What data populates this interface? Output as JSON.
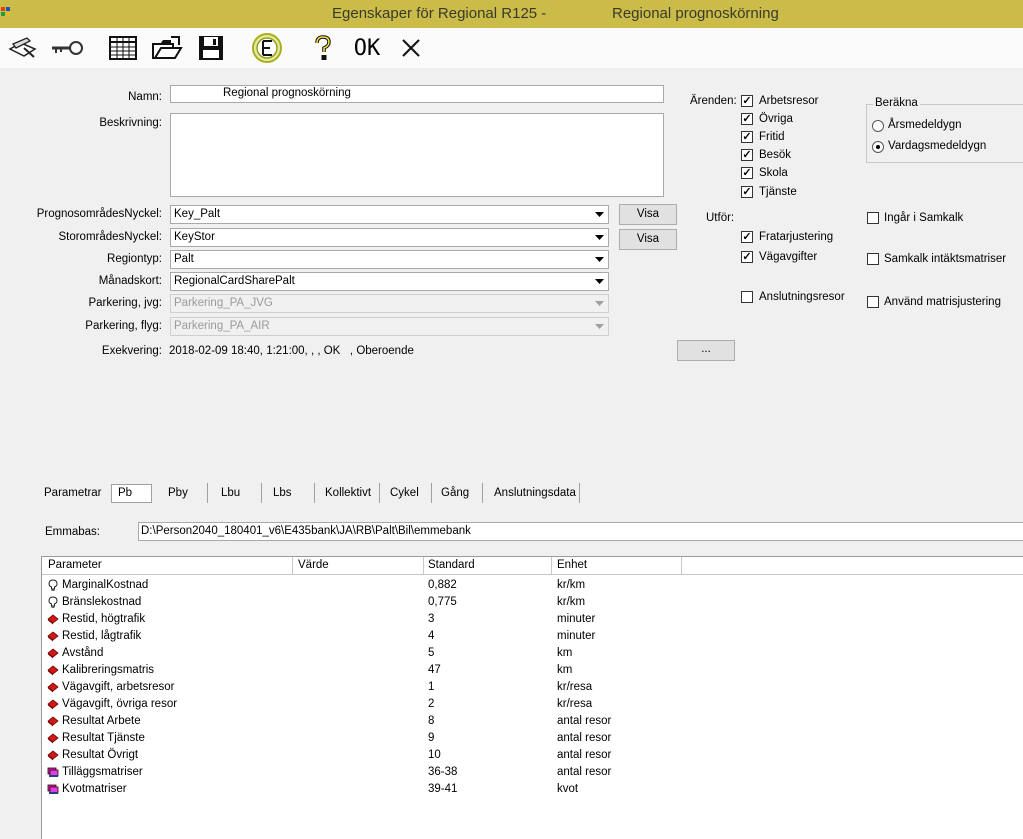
{
  "window": {
    "title_left": "Egenskaper för Regional R125 -",
    "title_right": "Regional prognoskörning"
  },
  "toolbar": {
    "ok_label": "OK",
    "icons": [
      "edit-icon",
      "key-icon",
      "grid-icon",
      "open-folder-icon",
      "save-icon",
      "emme-icon",
      "help-icon",
      "ok-icon",
      "close-icon"
    ]
  },
  "form": {
    "namn_label": "Namn:",
    "namn_value": "Regional prognoskörning",
    "beskrivning_label": "Beskrivning:",
    "beskrivning_value": "",
    "fields": [
      {
        "label": "PrognosområdesNyckel:",
        "value": "Key_Palt",
        "enabled": true
      },
      {
        "label": "StorområdesNyckel:",
        "value": "KeyStor",
        "enabled": true
      },
      {
        "label": "Regiontyp:",
        "value": "Palt",
        "enabled": true
      },
      {
        "label": "Månadskort:",
        "value": "RegionalCardSharePalt",
        "enabled": true
      },
      {
        "label": "Parkering, jvg:",
        "value": "Parkering_PA_JVG",
        "enabled": false
      },
      {
        "label": "Parkering, flyg:",
        "value": "Parkering_PA_AIR",
        "enabled": false
      }
    ],
    "visa_label": "Visa",
    "exekvering_label": "Exekvering:",
    "exekvering_value": "2018-02-09 18:40, 1:21:00, , , OK   , Oberoende",
    "ellipsis_label": "..."
  },
  "arenden": {
    "label": "Ärenden:",
    "items": [
      {
        "label": "Arbetsresor",
        "checked": true
      },
      {
        "label": "Övriga",
        "checked": true
      },
      {
        "label": "Fritid",
        "checked": true
      },
      {
        "label": "Besök",
        "checked": true
      },
      {
        "label": "Skola",
        "checked": true
      },
      {
        "label": "Tjänste",
        "checked": true
      }
    ]
  },
  "berakna": {
    "legend": "Beräkna",
    "options": [
      {
        "label": "Årsmedeldygn",
        "selected": false
      },
      {
        "label": "Vardagsmedeldygn",
        "selected": true
      }
    ]
  },
  "utfor": {
    "label": "Utför:",
    "items": [
      {
        "label": "Fratarjustering",
        "checked": true
      },
      {
        "label": "Vägavgifter",
        "checked": true
      },
      {
        "label": "Anslutningsresor",
        "checked": false
      }
    ],
    "right_items": [
      {
        "label": "Ingår i Samkalk",
        "checked": false
      },
      {
        "label": "Samkalk intäktsmatriser",
        "checked": false
      },
      {
        "label": "Använd matrisjustering",
        "checked": false
      }
    ]
  },
  "tabs": [
    "Parametrar",
    "Pb",
    "Pby",
    "Lbu",
    "Lbs",
    "Kollektivt",
    "Cykel",
    "Gång",
    "Anslutningsdata"
  ],
  "active_tab": "Pb",
  "emmabas": {
    "label": "Emmabas:",
    "value": "D:\\Person2040_180401_v6\\E435bank\\JA\\RB\\Palt\\Bil\\emmebank"
  },
  "table": {
    "columns": [
      "Parameter",
      "Värde",
      "Standard",
      "Enhet"
    ],
    "rows": [
      {
        "icon": "bulb-icon",
        "parameter": "MarginalKostnad",
        "varde": "",
        "standard": "0,882",
        "enhet": "kr/km"
      },
      {
        "icon": "bulb-icon",
        "parameter": "Bränslekostnad",
        "varde": "",
        "standard": "0,775",
        "enhet": "kr/km"
      },
      {
        "icon": "red-diamond-icon",
        "parameter": "Restid, högtrafik",
        "varde": "",
        "standard": "3",
        "enhet": "minuter"
      },
      {
        "icon": "red-diamond-icon",
        "parameter": "Restid, lågtrafik",
        "varde": "",
        "standard": "4",
        "enhet": "minuter"
      },
      {
        "icon": "red-diamond-icon",
        "parameter": "Avstånd",
        "varde": "",
        "standard": "5",
        "enhet": "km"
      },
      {
        "icon": "red-diamond-icon",
        "parameter": "Kalibreringsmatris",
        "varde": "",
        "standard": "47",
        "enhet": "km"
      },
      {
        "icon": "red-diamond-icon",
        "parameter": "Vägavgift, arbetsresor",
        "varde": "",
        "standard": "1",
        "enhet": "kr/resa"
      },
      {
        "icon": "red-diamond-icon",
        "parameter": "Vägavgift, övriga resor",
        "varde": "",
        "standard": "2",
        "enhet": "kr/resa"
      },
      {
        "icon": "red-diamond-icon",
        "parameter": "Resultat Arbete",
        "varde": "",
        "standard": "8",
        "enhet": "antal resor"
      },
      {
        "icon": "red-diamond-icon",
        "parameter": "Resultat Tjänste",
        "varde": "",
        "standard": "9",
        "enhet": "antal resor"
      },
      {
        "icon": "red-diamond-icon",
        "parameter": "Resultat Övrigt",
        "varde": "",
        "standard": "10",
        "enhet": "antal resor"
      },
      {
        "icon": "stack-icon",
        "parameter": "Tilläggsmatriser",
        "varde": "",
        "standard": "36-38",
        "enhet": "antal resor"
      },
      {
        "icon": "stack-icon",
        "parameter": "Kvotmatriser",
        "varde": "",
        "standard": "39-41",
        "enhet": "kvot"
      }
    ]
  }
}
